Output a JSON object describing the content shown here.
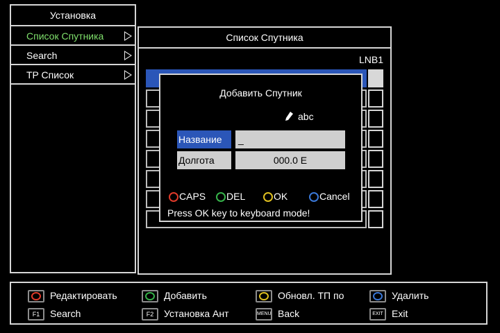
{
  "left_panel": {
    "title": "Установка",
    "items": [
      {
        "label": "Список Спутника",
        "active": true
      },
      {
        "label": "Search",
        "active": false
      },
      {
        "label": "TP Список",
        "active": false
      }
    ]
  },
  "right_panel": {
    "title": "Список Спутника",
    "lnb_label": "LNB1"
  },
  "dialog": {
    "title": "Добавить Спутник",
    "input_mode": "abc",
    "name_label": "Название",
    "name_value": "_",
    "longitude_label": "Долгота",
    "longitude_value": "000.0 E",
    "buttons": {
      "caps": "CAPS",
      "del": "DEL",
      "ok": "OK",
      "cancel": "Cancel"
    },
    "hint": "Press  OK key to keyboard mode!"
  },
  "bottom_bar": {
    "edit": "Редактировать",
    "add": "Добавить",
    "update_tp": "Обновл. ТП по",
    "delete": "Удалить",
    "f1_key": "F1",
    "search": "Search",
    "f2_key": "F2",
    "antenna_setup": "Установка Ант",
    "menu_key": "MENU",
    "back": "Back",
    "exit_key": "EXIT",
    "exit": "Exit"
  },
  "colors": {
    "red": "#e03a2a",
    "green": "#36b34a",
    "yellow": "#e0c020",
    "blue": "#3a78d8",
    "selection": "#2b56b8",
    "active_text": "#7fe06c"
  },
  "icons": {
    "pen": "pencil-icon",
    "arrow": "right-arrow-icon"
  }
}
